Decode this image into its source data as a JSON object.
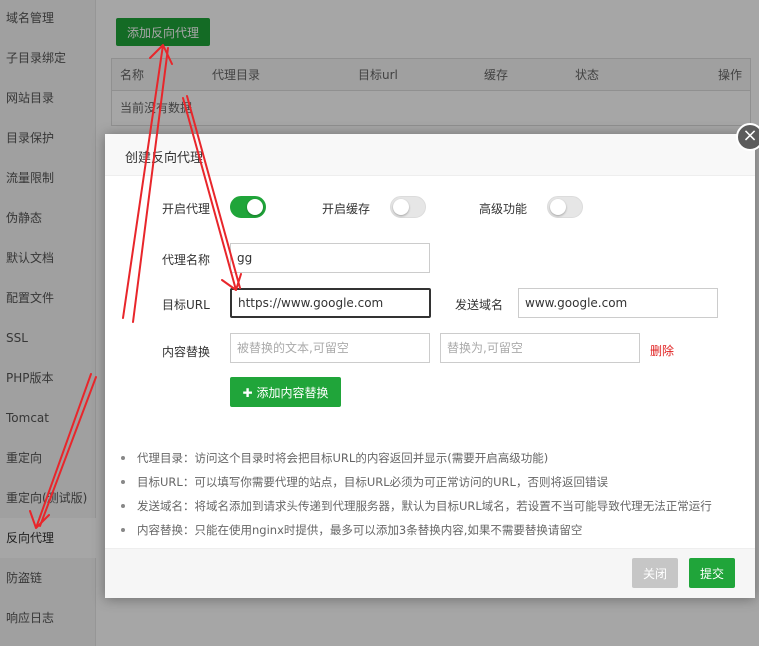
{
  "sidebar": {
    "items": [
      {
        "label": "域名管理"
      },
      {
        "label": "子目录绑定"
      },
      {
        "label": "网站目录"
      },
      {
        "label": "目录保护"
      },
      {
        "label": "流量限制"
      },
      {
        "label": "伪静态"
      },
      {
        "label": "默认文档"
      },
      {
        "label": "配置文件"
      },
      {
        "label": "SSL"
      },
      {
        "label": "PHP版本"
      },
      {
        "label": "Tomcat"
      },
      {
        "label": "重定向"
      },
      {
        "label": "重定向(测试版)"
      },
      {
        "label": "反向代理"
      },
      {
        "label": "防盗链"
      },
      {
        "label": "响应日志"
      }
    ],
    "active_index": 13
  },
  "main": {
    "add_button": "添加反向代理",
    "table": {
      "headers": [
        "名称",
        "代理目录",
        "目标url",
        "缓存",
        "状态",
        "操作"
      ],
      "empty_text": "当前没有数据"
    }
  },
  "dialog": {
    "title": "创建反向代理",
    "close_symbol": "×",
    "toggles": {
      "enable_proxy": {
        "label": "开启代理",
        "on": true
      },
      "enable_cache": {
        "label": "开启缓存",
        "on": false
      },
      "advanced": {
        "label": "高级功能",
        "on": false
      }
    },
    "proxy_name": {
      "label": "代理名称",
      "value": "gg"
    },
    "target_url": {
      "label": "目标URL",
      "value": "https://www.google.com"
    },
    "send_domain": {
      "label": "发送域名",
      "value": "www.google.com"
    },
    "content_replace": {
      "label": "内容替换",
      "from_placeholder": "被替换的文本,可留空",
      "to_placeholder": "替换为,可留空",
      "delete_label": "删除"
    },
    "add_replace_button": "添加内容替换",
    "add_replace_plus": "✚",
    "tips": [
      "代理目录：访问这个目录时将会把目标URL的内容返回并显示(需要开启高级功能)",
      "目标URL：可以填写你需要代理的站点，目标URL必须为可正常访问的URL，否则将返回错误",
      "发送域名：将域名添加到请求头传递到代理服务器，默认为目标URL域名，若设置不当可能导致代理无法正常运行",
      "内容替换：只能在使用nginx时提供，最多可以添加3条替换内容,如果不需要替换请留空"
    ],
    "footer": {
      "close_label": "关闭",
      "submit_label": "提交"
    }
  },
  "colors": {
    "accent": "#20a53a",
    "danger": "#e02020",
    "annotation": "#e8262b"
  }
}
